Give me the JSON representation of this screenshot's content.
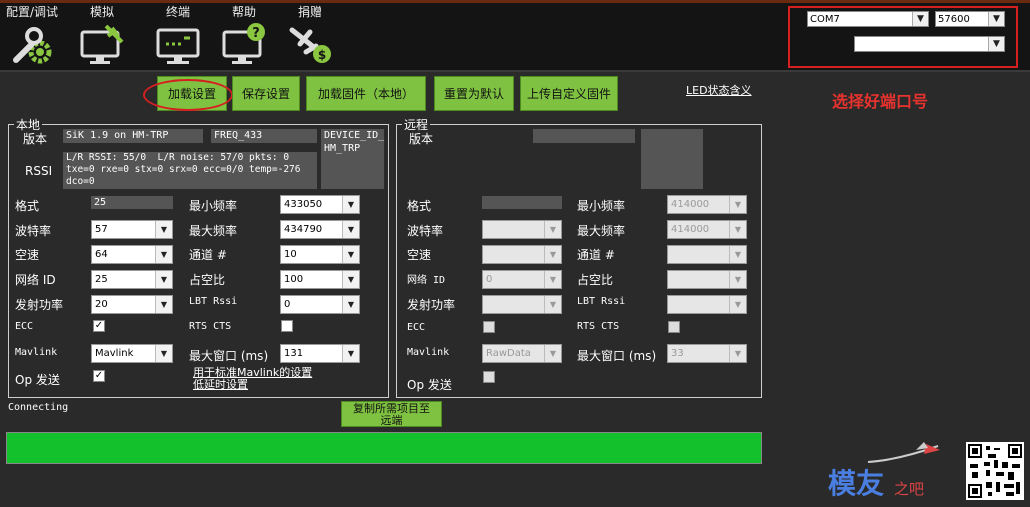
{
  "menu": [
    {
      "label": "配置/调试",
      "icon": "wrench-gear-icon"
    },
    {
      "label": "模拟",
      "icon": "monitor-plane-icon"
    },
    {
      "label": "终端",
      "icon": "terminal-monitor-icon"
    },
    {
      "label": "帮助",
      "icon": "help-monitor-icon"
    },
    {
      "label": "捐赠",
      "icon": "donate-plane-icon"
    }
  ],
  "port": {
    "com": "COM7",
    "baud": "57600",
    "extra": ""
  },
  "annotation": "选择好端口号",
  "actions": {
    "load": "加载设置",
    "save": "保存设置",
    "load_fw": "加载固件（本地）",
    "reset": "重置为默认",
    "upload_fw": "上传自定义固件",
    "led": "LED状态含义"
  },
  "local": {
    "title": "本地",
    "version_label": "版本",
    "version": "SiK 1.9 on HM-TRP",
    "freq": "FREQ_433",
    "device_id": "DEVICE_ID_\nHM_TRP",
    "rssi_label": "RSSI",
    "rssi": "L/R RSSI: 55/0  L/R noise: 57/0 pkts: 0\ntxe=0 rxe=0 stx=0 srx=0 ecc=0/0 temp=-276\ndco=0",
    "format_label": "格式",
    "format": "25",
    "baud_label": "波特率",
    "baud": "57",
    "airspeed_label": "空速",
    "airspeed": "64",
    "netid_label": "网络 ID",
    "netid": "25",
    "txpower_label": "发射功率",
    "txpower": "20",
    "ecc_label": "ECC",
    "mavlink_label": "Mavlink",
    "mavlink": "Mavlink",
    "op_label": "Op 发送",
    "minfreq_label": "最小频率",
    "minfreq": "433050",
    "maxfreq_label": "最大频率",
    "maxfreq": "434790",
    "channels_label": "通道 #",
    "channels": "10",
    "duty_label": "占空比",
    "duty": "100",
    "lbt_label": "LBT Rssi",
    "lbt": "0",
    "rts_label": "RTS CTS",
    "maxwin_label": "最大窗口 (ms)",
    "maxwin": "131",
    "hint": "用于标准Mavlink的设置\n低延时设置"
  },
  "remote": {
    "title": "远程",
    "version_label": "版本",
    "format_label": "格式",
    "baud_label": "波特率",
    "airspeed_label": "空速",
    "netid_label": "网络 ID",
    "netid": "0",
    "txpower_label": "发射功率",
    "ecc_label": "ECC",
    "mavlink_label": "Mavlink",
    "mavlink": "RawData",
    "op_label": "Op 发送",
    "minfreq_label": "最小频率",
    "minfreq": "414000",
    "maxfreq_label": "最大频率",
    "maxfreq": "414000",
    "channels_label": "通道 #",
    "duty_label": "占空比",
    "lbt_label": "LBT Rssi",
    "rts_label": "RTS CTS",
    "maxwin_label": "最大窗口 (ms)",
    "maxwin": "33"
  },
  "status": "Connecting",
  "copy_button": "复制所需项目至\n远端",
  "progress": 1.0,
  "watermark": {
    "text": "模友",
    "sub": "之吧"
  },
  "colors": {
    "accent_green": "#7fc241",
    "progress_green": "#12c12c",
    "highlight_red": "#d42020"
  }
}
